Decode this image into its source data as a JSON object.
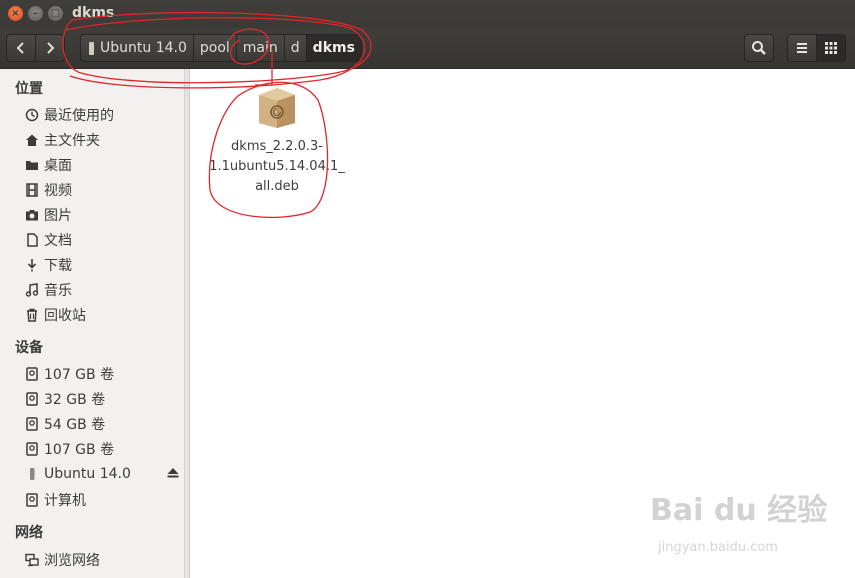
{
  "window": {
    "title": "dkms"
  },
  "toolbar": {
    "breadcrumbs": [
      "Ubuntu 14.0",
      "pool",
      "main",
      "d",
      "dkms"
    ]
  },
  "sidebar": {
    "places_heading": "位置",
    "places": [
      {
        "label": "最近使用的",
        "icon": "clock-icon"
      },
      {
        "label": "主文件夹",
        "icon": "home-icon"
      },
      {
        "label": "桌面",
        "icon": "folder-icon"
      },
      {
        "label": "视频",
        "icon": "film-icon"
      },
      {
        "label": "图片",
        "icon": "camera-icon"
      },
      {
        "label": "文档",
        "icon": "document-icon"
      },
      {
        "label": "下载",
        "icon": "download-icon"
      },
      {
        "label": "音乐",
        "icon": "music-icon"
      },
      {
        "label": "回收站",
        "icon": "trash-icon"
      }
    ],
    "devices_heading": "设备",
    "devices": [
      {
        "label": "107 GB 卷",
        "icon": "drive-icon"
      },
      {
        "label": "32 GB 卷",
        "icon": "drive-icon"
      },
      {
        "label": "54 GB 卷",
        "icon": "drive-icon"
      },
      {
        "label": "107 GB 卷",
        "icon": "drive-icon"
      },
      {
        "label": "Ubuntu 14.0",
        "icon": "usb-drive-icon"
      },
      {
        "label": "计算机",
        "icon": "drive-icon"
      }
    ],
    "network_heading": "网络",
    "network": [
      {
        "label": "浏览网络",
        "icon": "network-icon"
      }
    ]
  },
  "files": [
    {
      "name_lines": [
        "dkms_2.2.0.3-",
        "1.1ubuntu5.14.04.1_",
        "all.deb"
      ],
      "icon": "deb-package-icon"
    }
  ],
  "watermark": {
    "brand": "Bai du 经验",
    "url": "jingyan.baidu.com"
  },
  "colors": {
    "close": "#dd4814",
    "toolbar": "#3c3b37",
    "sidebar": "#f2f1ef",
    "annotation": "#e0262b"
  }
}
